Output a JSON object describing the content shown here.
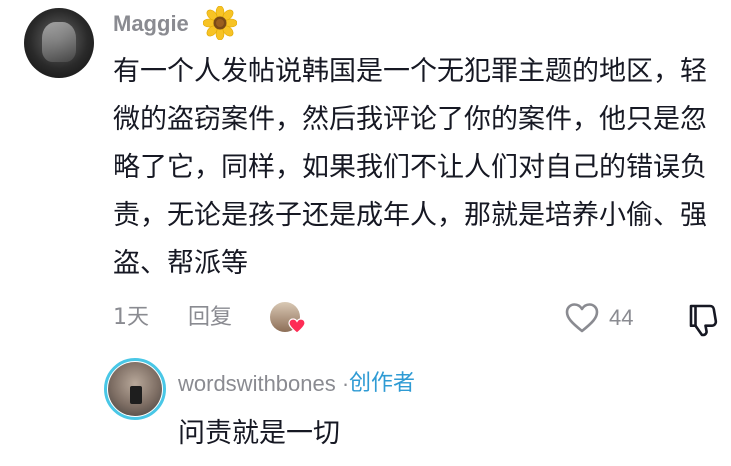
{
  "comment": {
    "username": "Maggie",
    "username_emoji": "sunflower-icon",
    "text": "有一个人发帖说韩国是一个无犯罪主题的地区，轻微的盗窃案件，然后我评论了你的案件，他只是忽略了它，同样，如果我们不让人们对自己的错误负责，无论是孩子还是成年人，那就是培养小偷、强盗、帮派等",
    "time": "1天",
    "reply_label": "回复",
    "like_count": "44"
  },
  "reply": {
    "username": "wordswithbones",
    "separator": " · ",
    "badge": "创作者",
    "text": "问责就是一切"
  },
  "colors": {
    "secondary_text": "#8a8b91",
    "primary_text": "#161823",
    "creator_blue": "#2f9bd4",
    "ring_blue": "#49c7e6",
    "heart_pink": "#fe2c55"
  }
}
